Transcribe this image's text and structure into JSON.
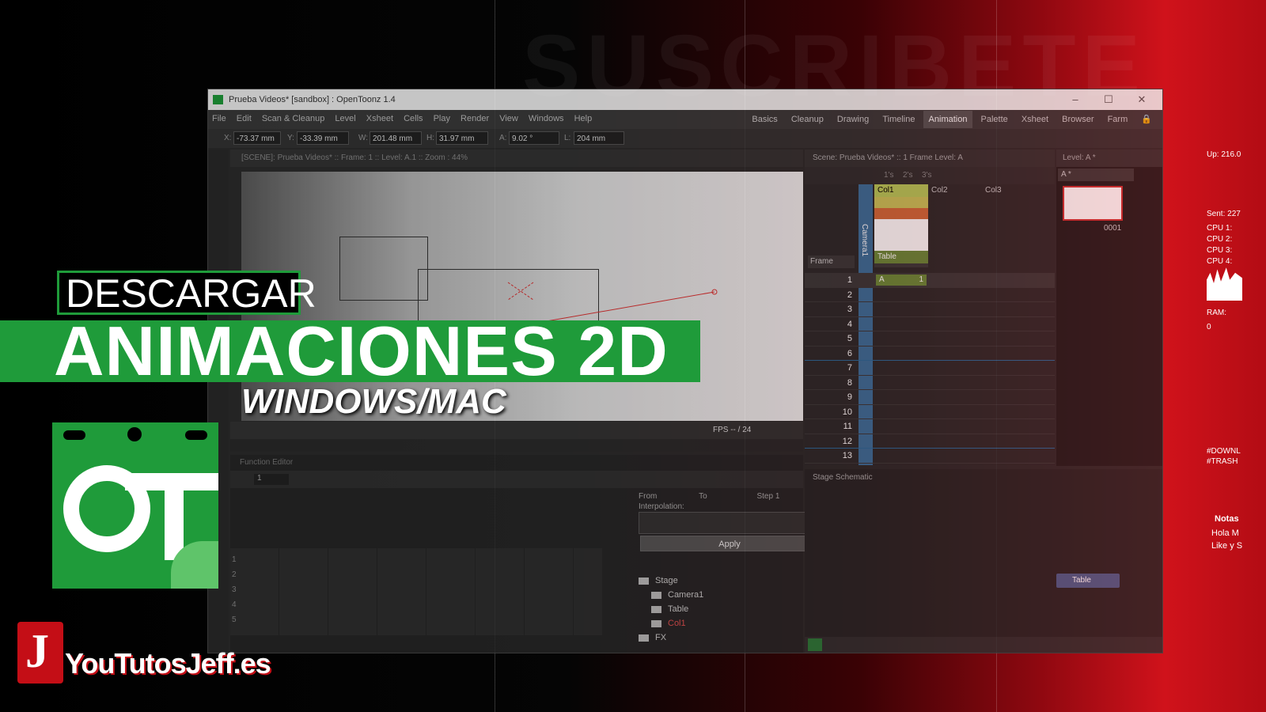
{
  "background": {
    "watermark": "SUSCRIBETE"
  },
  "window": {
    "title": "Prueba Videos* [sandbox] : OpenToonz 1.4",
    "controls": [
      "–",
      "☐",
      "✕"
    ],
    "menu": [
      "File",
      "Edit",
      "Scan & Cleanup",
      "Level",
      "Xsheet",
      "Cells",
      "Play",
      "Render",
      "View",
      "Windows",
      "Help"
    ],
    "rooms": [
      "Basics",
      "Cleanup",
      "Drawing",
      "Timeline",
      "Animation",
      "Palette",
      "Xsheet",
      "Browser",
      "Farm"
    ],
    "active_room": "Animation",
    "tool_options": {
      "x_label": "X:",
      "x_value": "-73.37 mm",
      "y_label": "Y:",
      "y_value": "-33.39 mm",
      "w_label": "W:",
      "w_value": "201.48 mm",
      "h_label": "H:",
      "h_value": "31.97 mm",
      "a_label": "A:",
      "a_value": "9.02 °",
      "l_label": "L:",
      "l_value": "204 mm"
    },
    "viewer": {
      "header": "[SCENE]: Prueba Videos*  ::  Frame: 1  ::  Level: A.1  ::  Zoom : 44%",
      "fps_label": "FPS -- / 24"
    },
    "function_editor": {
      "title": "Function Editor",
      "frame_value": "1",
      "from_label": "From",
      "to_label": "To",
      "step_label": "Step",
      "step_value": "1",
      "interpolation_label": "Interpolation:",
      "apply_label": "Apply",
      "row_numbers": [
        "1",
        "2",
        "3",
        "4",
        "5"
      ],
      "tree": [
        {
          "label": "Stage",
          "color": "#cccccc"
        },
        {
          "label": "Camera1",
          "color": "#cccccc"
        },
        {
          "label": "Table",
          "color": "#cccccc"
        },
        {
          "label": "Col1",
          "color": "#e05050"
        },
        {
          "label": "FX",
          "color": "#cccccc"
        }
      ]
    },
    "xsheet": {
      "header": "Scene: Prueba Videos*  ::  1 Frame  Level: A",
      "step_labels": [
        "1's",
        "2's",
        "3's"
      ],
      "frame_label": "Frame",
      "camera_label": "Camera1",
      "columns": [
        "Col1",
        "Col2",
        "Col3"
      ],
      "col1_pegbar": "Table",
      "cell_level": "A",
      "cell_frame": "1",
      "rows": [
        "1",
        "2",
        "3",
        "4",
        "5",
        "6",
        "7",
        "8",
        "9",
        "10",
        "11",
        "12",
        "13"
      ]
    },
    "level_strip": {
      "header": "Level:  A *",
      "selector": "A *",
      "frame_number": "0001"
    },
    "schematic": {
      "title": "Stage Schematic",
      "node_label": "Table"
    }
  },
  "overlay": {
    "descargar": "DESCARGAR",
    "headline": "ANIMACIONES 2D",
    "platforms": "WINDOWS/MAC",
    "brand_site": "YouTutosJeff.es",
    "brand_initial": "J"
  },
  "side_stats": {
    "up": "Up: 216.0",
    "sent": "Sent:  227",
    "cpu": [
      "CPU 1:",
      "CPU 2:",
      "CPU 3:",
      "CPU 4:"
    ],
    "ram_label": "RAM:",
    "ram_value": "0",
    "hashtags": [
      "#DOWNL",
      "#TRASH"
    ],
    "notes_title": "Notas",
    "notes_lines": [
      "Hola M",
      "Like y S"
    ]
  },
  "colors": {
    "brand_green": "#1f9b3a",
    "brand_red": "#c40e16",
    "xsheet_blue": "#3a6f9a"
  }
}
